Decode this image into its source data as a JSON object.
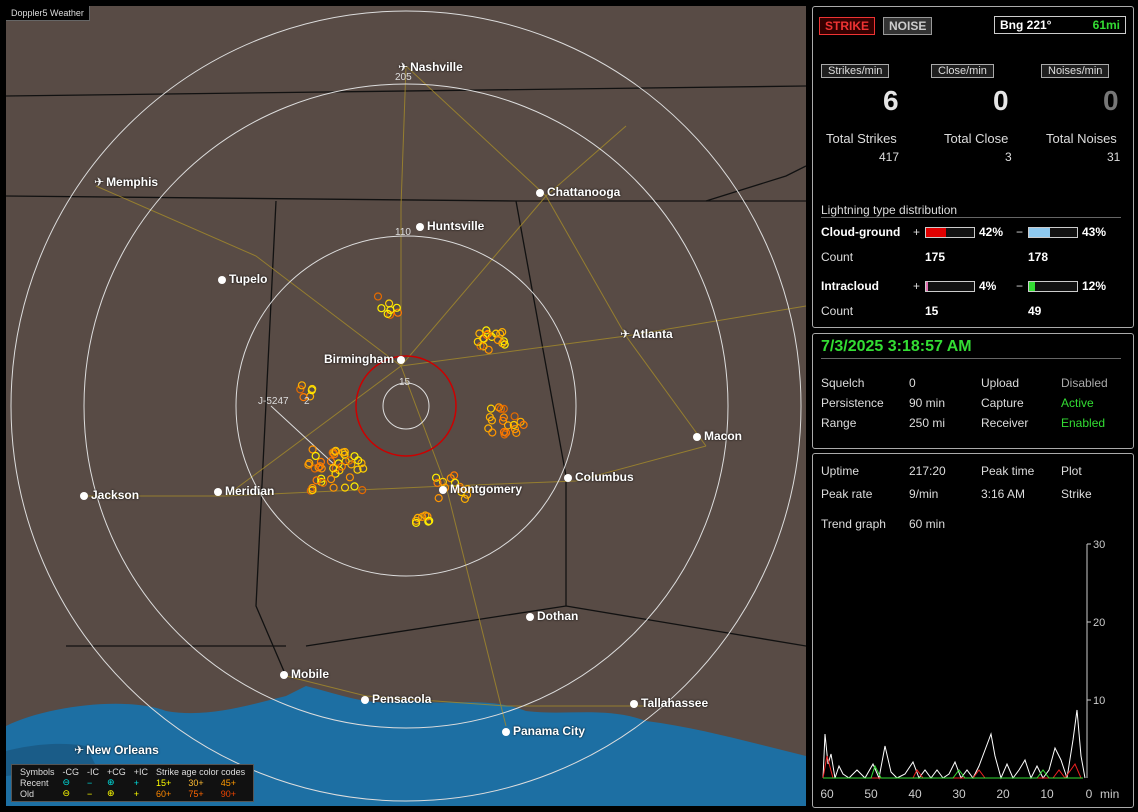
{
  "app_title": "Doppler5 Weather",
  "cities": [
    {
      "name": "Nashville",
      "type": "airport"
    },
    {
      "name": "Memphis",
      "type": "airport"
    },
    {
      "name": "Chattanooga",
      "type": "city"
    },
    {
      "name": "Huntsville",
      "type": "city"
    },
    {
      "name": "Tupelo",
      "type": "city"
    },
    {
      "name": "Atlanta",
      "type": "airport"
    },
    {
      "name": "Birmingham",
      "type": "city"
    },
    {
      "name": "Macon",
      "type": "city"
    },
    {
      "name": "Jackson",
      "type": "city"
    },
    {
      "name": "Meridian",
      "type": "city"
    },
    {
      "name": "Columbus",
      "type": "city"
    },
    {
      "name": "Montgomery",
      "type": "city"
    },
    {
      "name": "Dothan",
      "type": "city"
    },
    {
      "name": "Mobile",
      "type": "city"
    },
    {
      "name": "Pensacola",
      "type": "city"
    },
    {
      "name": "Tallahassee",
      "type": "city"
    },
    {
      "name": "Panama City",
      "type": "city"
    },
    {
      "name": "New Orleans",
      "type": "airport"
    }
  ],
  "range_labels": [
    "205",
    "110",
    "15"
  ],
  "cursor_label": "J-5247",
  "cursor_num": "2",
  "legend": {
    "headers": [
      "Symbols",
      "-CG",
      "-IC",
      "+CG",
      "+IC",
      "Strike age color codes"
    ],
    "rows": [
      {
        "label": "Recent",
        "ages": [
          "15+",
          "30+",
          "45+"
        ]
      },
      {
        "label": "Old",
        "ages": [
          "60+",
          "75+",
          "90+"
        ]
      }
    ]
  },
  "strike_btn": "STRIKE",
  "noise_btn": "NOISE",
  "bearing": "Bng 221°",
  "bearing_dist": "61mi",
  "rates": [
    {
      "label": "Strikes/min",
      "value": "6"
    },
    {
      "label": "Close/min",
      "value": "0"
    },
    {
      "label": "Noises/min",
      "value": "0"
    }
  ],
  "totals": [
    {
      "label": "Total Strikes",
      "value": "417"
    },
    {
      "label": "Total Close",
      "value": "3"
    },
    {
      "label": "Total Noises",
      "value": "31"
    }
  ],
  "dist_title": "Lightning type distribution",
  "cg": {
    "label": "Cloud-ground",
    "pos_pct": "42%",
    "neg_pct": "43%",
    "pos": 0.42,
    "neg": 0.43,
    "count_label": "Count",
    "pos_count": "175",
    "neg_count": "178"
  },
  "ic": {
    "label": "Intracloud",
    "pos_pct": "4%",
    "neg_pct": "12%",
    "pos": 0.04,
    "neg": 0.12,
    "count_label": "Count",
    "pos_count": "15",
    "neg_count": "49"
  },
  "datetime": "7/3/2025 3:18:57 AM",
  "status": [
    {
      "l": "Squelch",
      "v": "0",
      "l2": "Upload",
      "v2": "Disabled"
    },
    {
      "l": "Persistence",
      "v": "90 min",
      "l2": "Capture",
      "v2": "Active"
    },
    {
      "l": "Range",
      "v": "250 mi",
      "l2": "Receiver",
      "v2": "Enabled"
    }
  ],
  "stats": {
    "uptime_l": "Uptime",
    "uptime": "217:20",
    "peak_time_l": "Peak time",
    "plot_l": "Plot",
    "peak_rate_l": "Peak rate",
    "peak_rate": "9/min",
    "peak_time": "3:16 AM",
    "plot": "Strike",
    "trend_l": "Trend graph",
    "trend": "60 min"
  },
  "trend_axis": {
    "y": [
      "30",
      "20",
      "10"
    ],
    "x": [
      "60",
      "50",
      "40",
      "30",
      "20",
      "10",
      "0"
    ],
    "unit": "min"
  },
  "colors": {
    "map": "#584b45",
    "water": "#1d6fa3",
    "strike_green": "#2ecc40",
    "cg_pos": "#e00000",
    "cg_neg": "#8ec9ef",
    "ic_pos": "#e070b0",
    "ic_neg": "#33dd33"
  }
}
